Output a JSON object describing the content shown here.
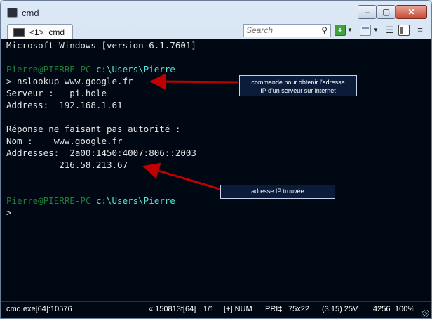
{
  "window": {
    "title": "cmd",
    "controls": {
      "minimize": "–",
      "maximize": "▢",
      "close": "✕"
    }
  },
  "tab": {
    "label": "<1>  cmd"
  },
  "search": {
    "placeholder": "Search"
  },
  "toolbar": {
    "add_icon": "+",
    "dropdown_icon": "▼",
    "list_icon": "☰",
    "menu_icon": "≡"
  },
  "console": {
    "lines": {
      "version": "Microsoft Windows [version 6.1.7601]",
      "prompt1_user": "Pierre@PIERRE-PC",
      "prompt1_path": "c:\\Users\\Pierre",
      "command": "> nslookup www.google.fr",
      "server": "Serveur :   pi.hole",
      "address": "Address:  192.168.1.61",
      "nonauth": "Réponse ne faisant pas autorité :",
      "name": "Nom :    www.google.fr",
      "addresses": "Addresses:  2a00:1450:4007:806::2003",
      "ipv4": "          216.58.213.67",
      "prompt2_user": "Pierre@PIERRE-PC",
      "prompt2_path": "c:\\Users\\Pierre",
      "cursor": ">"
    },
    "colors": {
      "background": "#000814",
      "prompt_user": "#1f7f3b",
      "prompt_path": "#53e3d2",
      "arrow": "#c00000"
    }
  },
  "annotations": {
    "cmd_note_line1": "commande pour obtenir l'adresse",
    "cmd_note_line2": "IP d'un serveur sur internet",
    "ip_note": "adresse IP trouvée"
  },
  "status": {
    "process": "cmd.exe[64]:10576",
    "code": "« 150813f[64]",
    "pages": "1/1",
    "flags": "[+] NUM",
    "priority": "PRI‡",
    "size": "75x22",
    "cursor": "(3,15) 25V",
    "memory": "4256",
    "zoom": "100%"
  }
}
